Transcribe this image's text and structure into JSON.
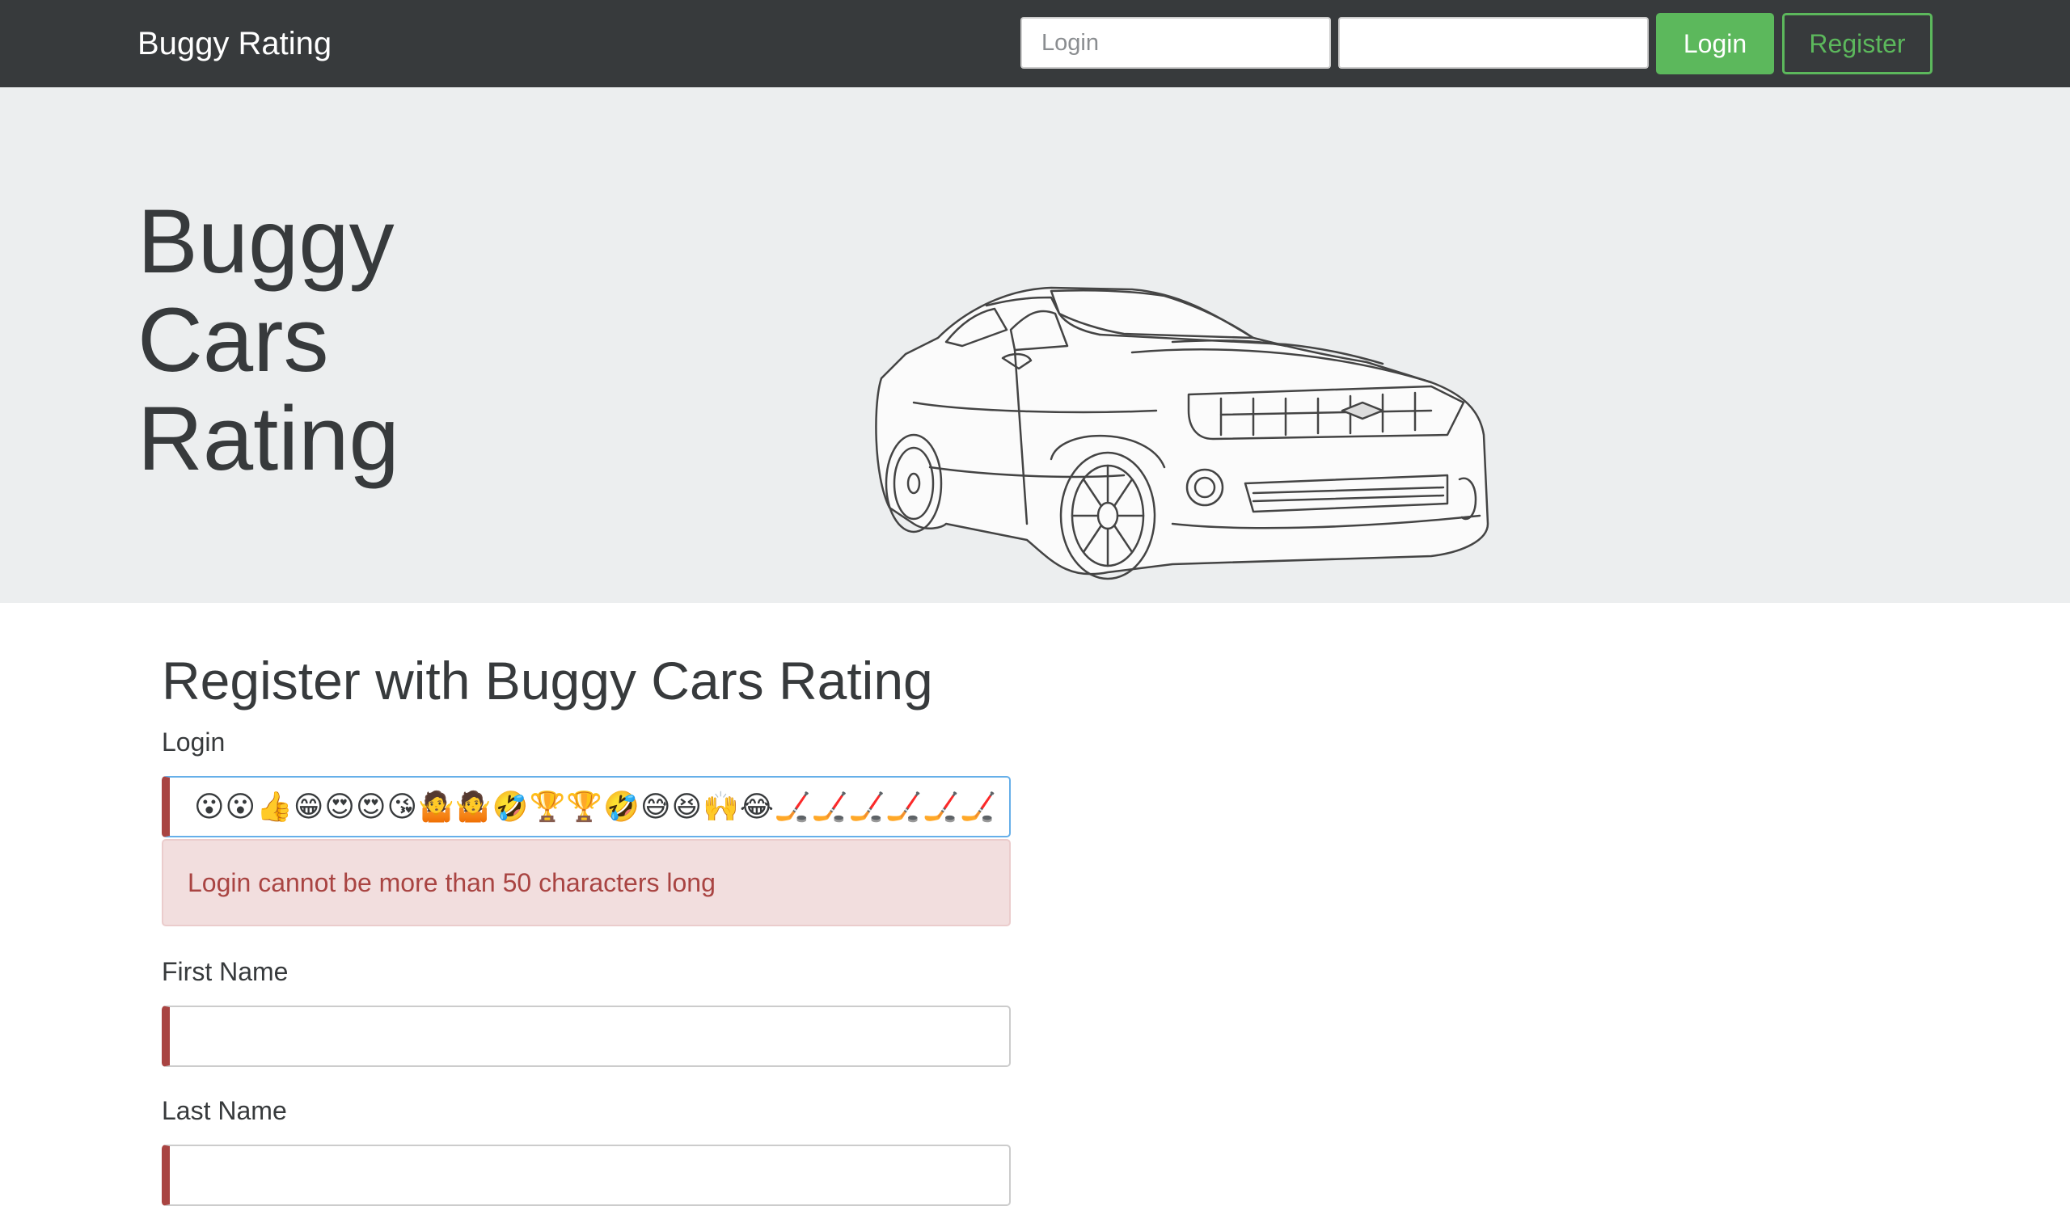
{
  "navbar": {
    "brand": "Buggy Rating",
    "login_placeholder": "Login",
    "password_value": "",
    "login_button": "Login",
    "register_button": "Register"
  },
  "hero": {
    "title_lines": [
      "Buggy",
      "Cars",
      "Rating"
    ],
    "image": "car-outline-illustration"
  },
  "register": {
    "title": "Register with Buggy Cars Rating",
    "login_label": "Login",
    "login_value": "😮😮👍😁😍😍😘🤷🤷🤣🏆🏆🤣😅😆🙌😂🏒🏒🏒🏒🏒🏒",
    "login_error": "Login cannot be more than 50 characters long",
    "first_name_label": "First Name",
    "first_name_value": "",
    "last_name_label": "Last Name",
    "last_name_value": ""
  },
  "colors": {
    "navbar_bg": "#373a3c",
    "hero_bg": "#eceeef",
    "accent_green": "#5cb85c",
    "error_red": "#a94442",
    "alert_bg": "#f2dede"
  }
}
